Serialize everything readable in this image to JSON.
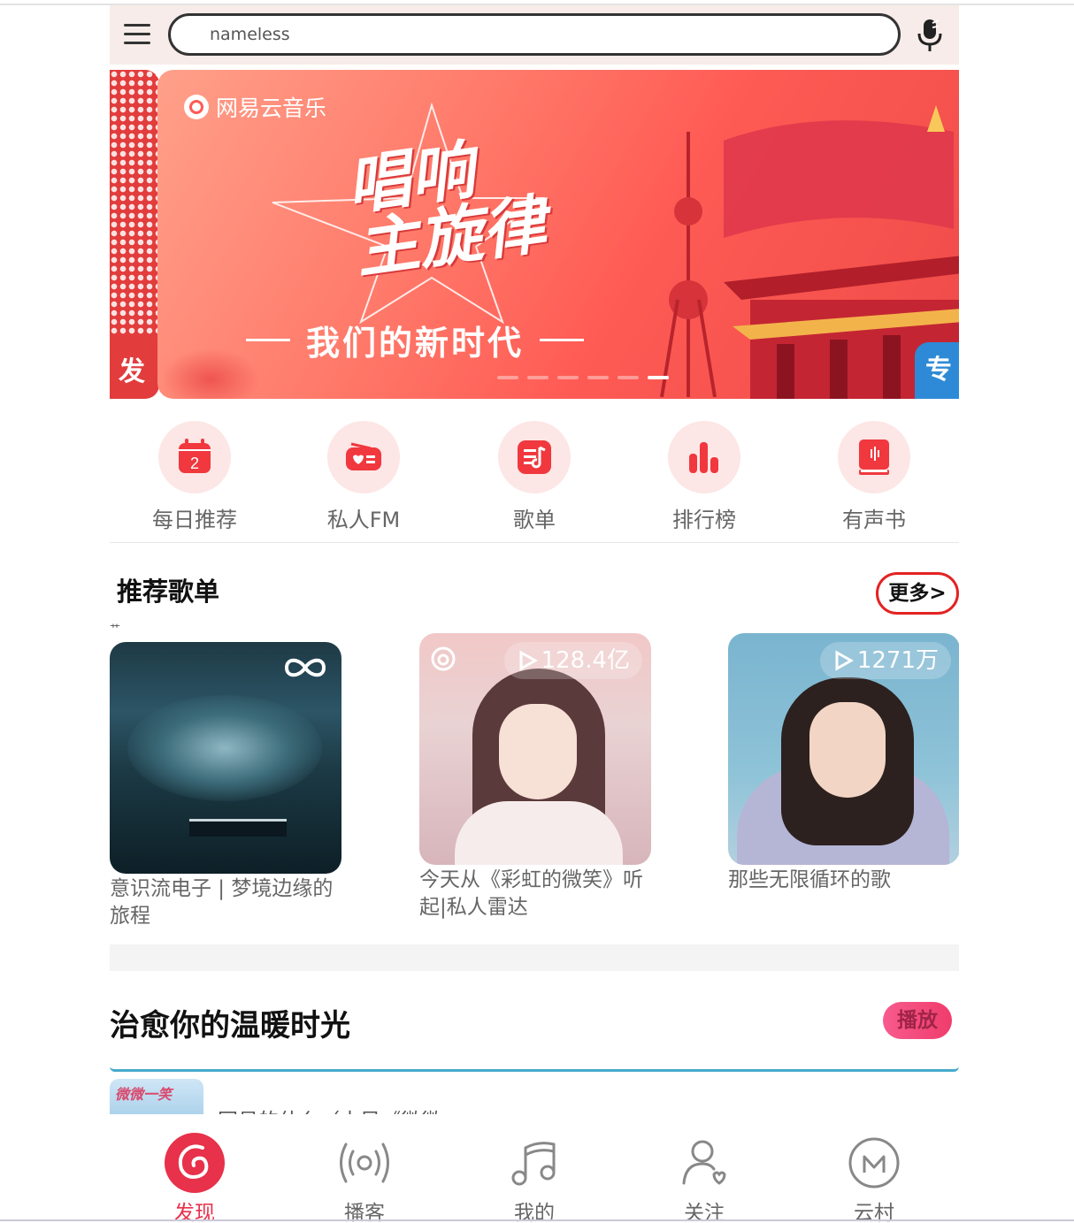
{
  "header": {
    "search_value": "nameless",
    "menu_icon": "hamburger-icon",
    "mic_icon": "microphone-icon"
  },
  "banner": {
    "brand": "网易云音乐",
    "title_line1": "唱响",
    "title_line2": "主旋律",
    "subtitle": "我们的新时代",
    "prev_tag": "发",
    "next_tag": "专",
    "dot_count": 6,
    "active_dot": 5
  },
  "quick_nav": [
    {
      "label": "每日推荐",
      "icon": "calendar-icon",
      "badge": "2"
    },
    {
      "label": "私人FM",
      "icon": "radio-icon"
    },
    {
      "label": "歌单",
      "icon": "playlist-icon"
    },
    {
      "label": "排行榜",
      "icon": "chart-bars-icon"
    },
    {
      "label": "有声书",
      "icon": "audiobook-icon"
    }
  ],
  "recommend": {
    "title": "推荐歌单",
    "more_label": "更多>",
    "tiny_mark": "艹",
    "playlists": [
      {
        "title": "意识流电子 | 梦境边缘的旅程",
        "play_count": ""
      },
      {
        "title": "今天从《彩虹的微笑》听起|私人雷达",
        "play_count": "128.4亿"
      },
      {
        "title": "那些无限循环的歌",
        "play_count": "1271万"
      }
    ]
  },
  "healing": {
    "title": "治愈你的温暖时光",
    "play_label": "播放",
    "song_name": "网易的什么（古风《微微",
    "thumb_text": "微微一笑"
  },
  "tabbar": [
    {
      "label": "发现",
      "icon": "netease-logo-icon",
      "active": true
    },
    {
      "label": "播客",
      "icon": "podcast-icon"
    },
    {
      "label": "我的",
      "icon": "music-note-icon"
    },
    {
      "label": "关注",
      "icon": "follow-user-icon"
    },
    {
      "label": "云村",
      "icon": "cloud-village-icon"
    }
  ],
  "colors": {
    "brand_red": "#e8314a",
    "header_bg": "#f7ece9",
    "more_border": "#e32323",
    "accent_line": "#46aacb"
  }
}
